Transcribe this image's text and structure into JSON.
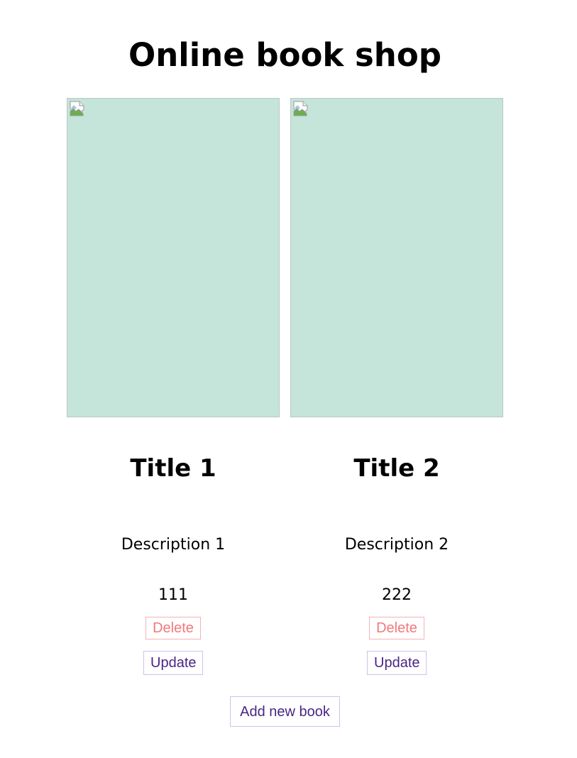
{
  "header": {
    "title": "Online book shop"
  },
  "books": [
    {
      "title": "Title 1",
      "description": "Description 1",
      "price": "111",
      "delete_label": "Delete",
      "update_label": "Update"
    },
    {
      "title": "Title 2",
      "description": "Description 2",
      "price": "222",
      "delete_label": "Delete",
      "update_label": "Update"
    }
  ],
  "actions": {
    "add_label": "Add new book"
  },
  "icons": {
    "cover": "broken-image-icon"
  },
  "colors": {
    "cover_bg": "#c5e4da",
    "delete_text": "#f2787a",
    "delete_border": "#f3b3b6",
    "update_text": "#4b2585",
    "update_border": "#cdc2ea"
  }
}
